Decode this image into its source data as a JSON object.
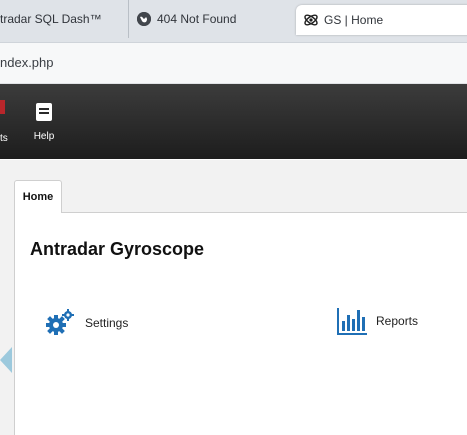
{
  "browser": {
    "tabs": [
      {
        "label": "tradar SQL Dash™"
      },
      {
        "label": "404 Not Found"
      },
      {
        "label": "GS | Home"
      }
    ],
    "url": "ndex.php"
  },
  "toolbar": {
    "partial_label": "ts",
    "help_label": "Help"
  },
  "page": {
    "tab_label": "Home",
    "title": "Antradar Gyroscope",
    "items": [
      {
        "label": "Settings",
        "icon": "gears-icon"
      },
      {
        "label": "Reports",
        "icon": "bar-chart-icon"
      }
    ]
  },
  "colors": {
    "toolbar_bg": "#2a2a2a",
    "accent": "#1f6fb5",
    "arrow": "#9cc9dd"
  }
}
